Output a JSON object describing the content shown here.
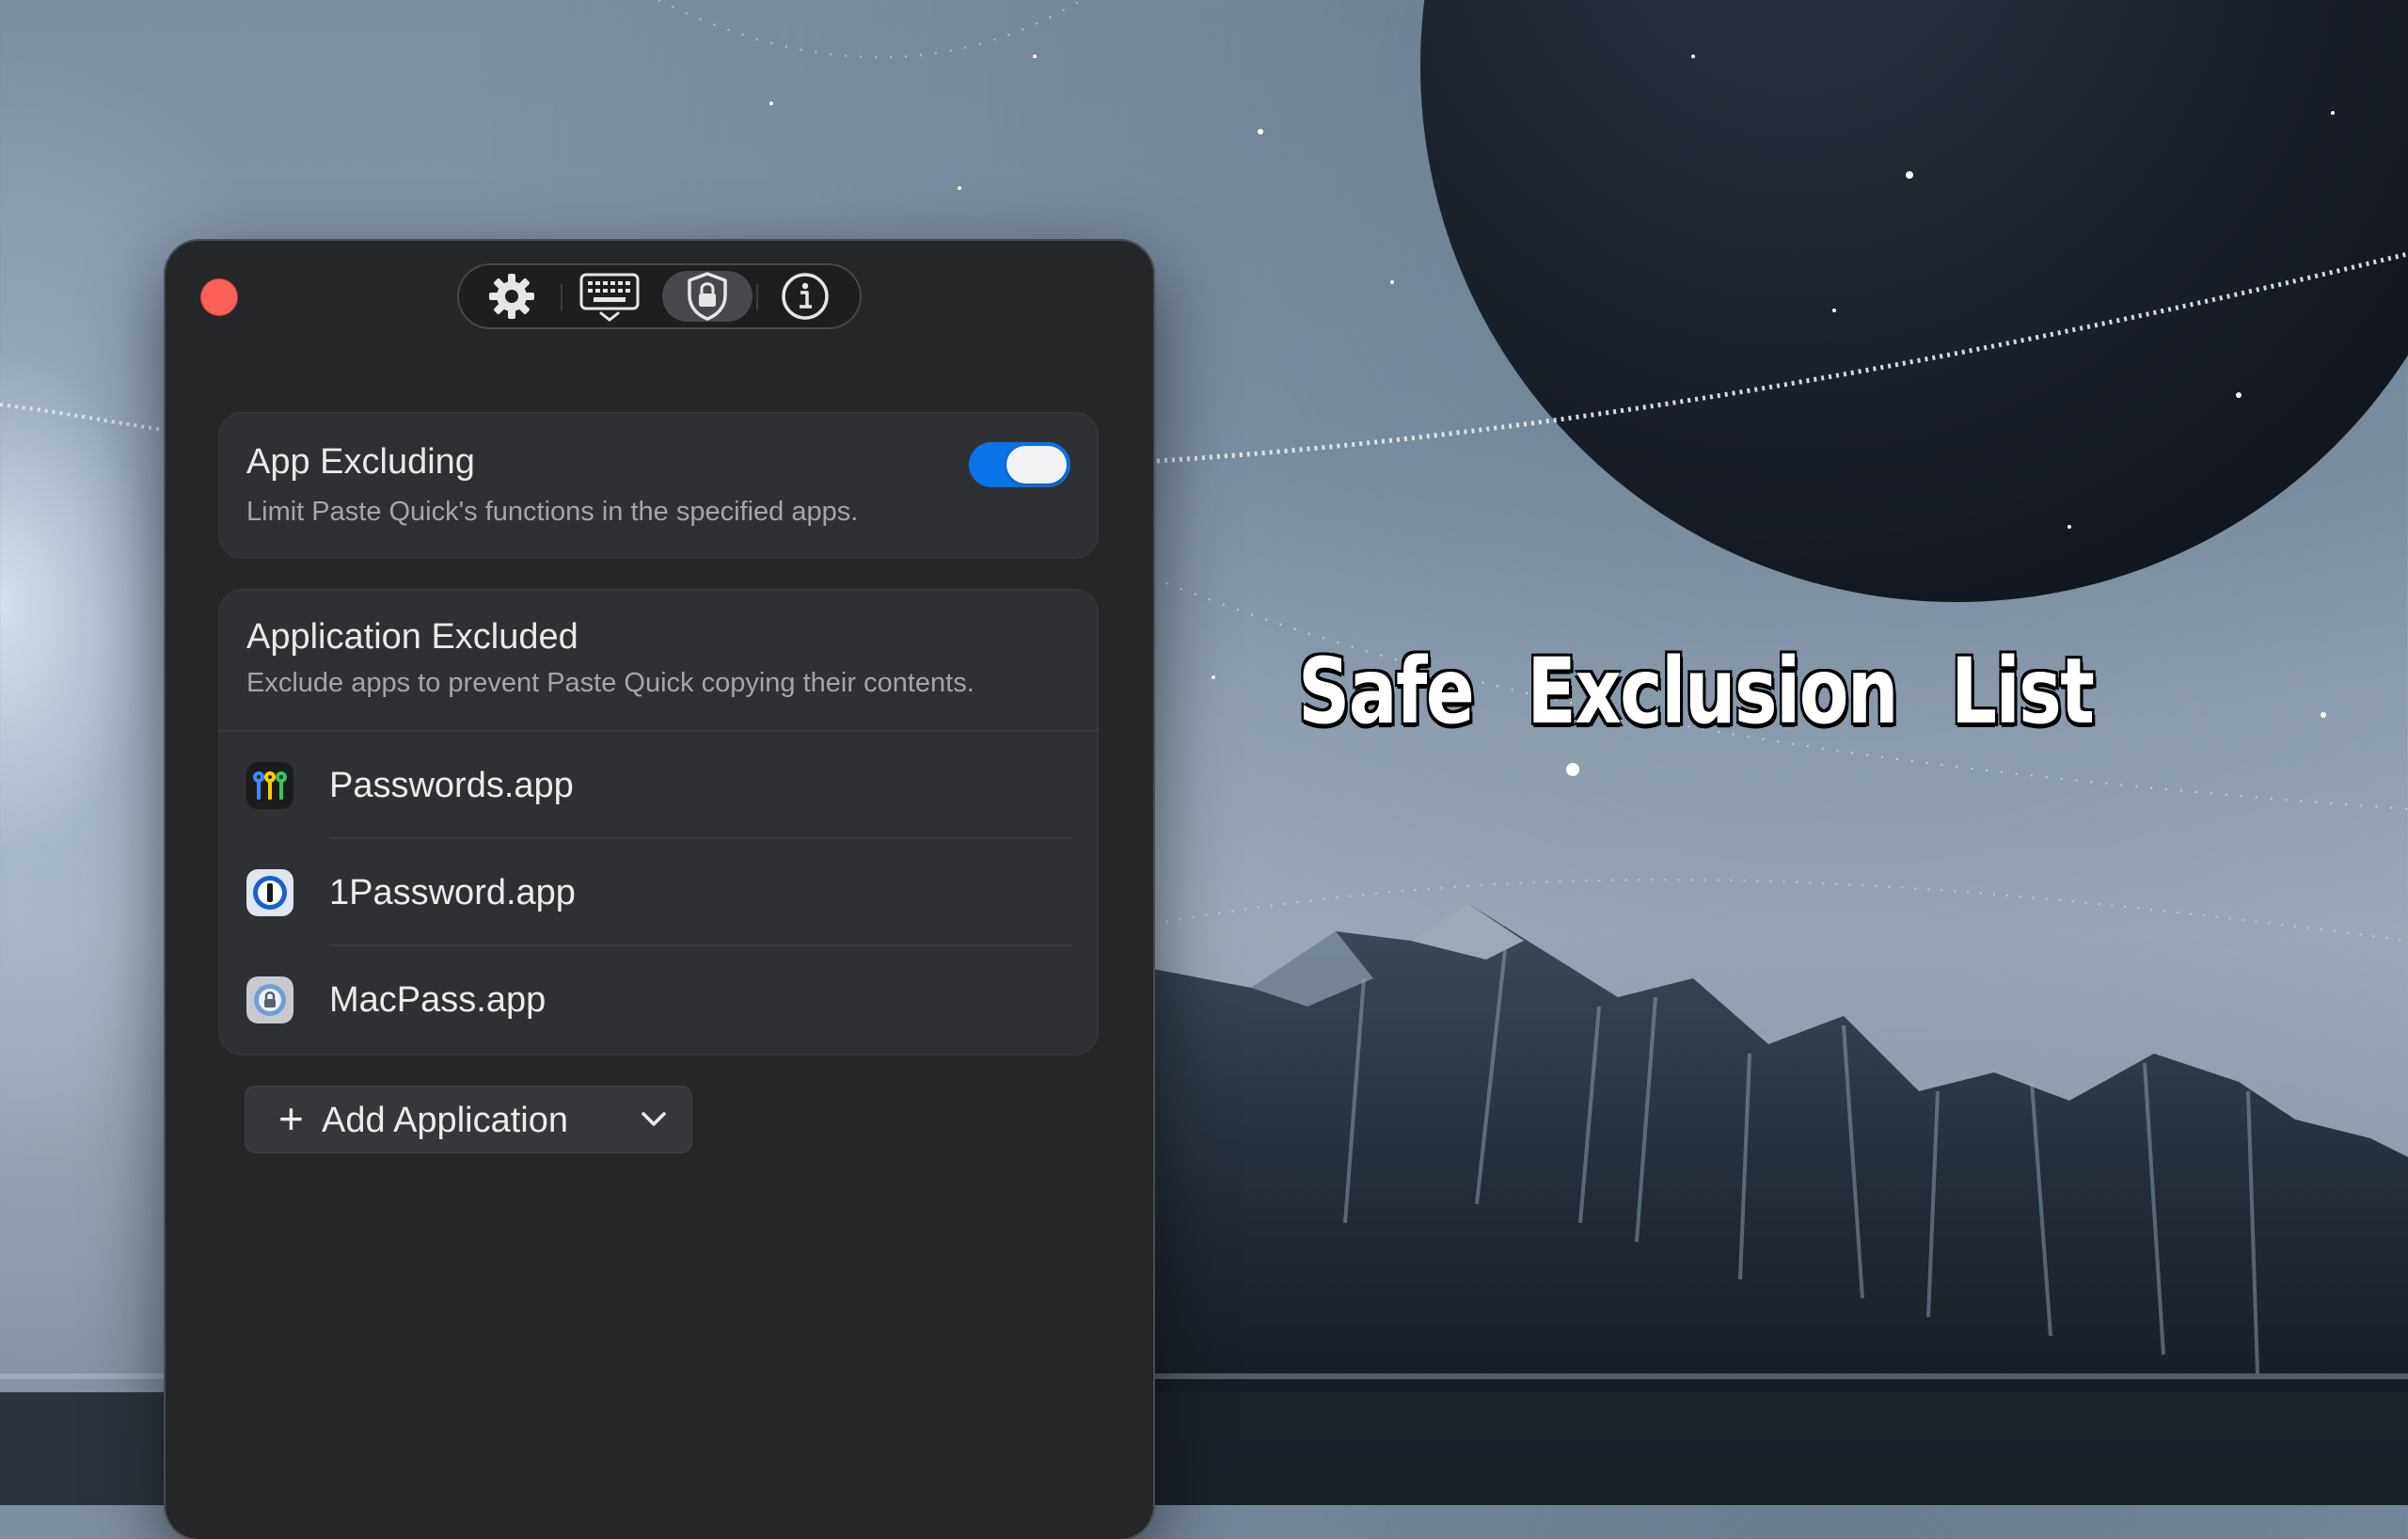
{
  "promo": {
    "headline": "Safe  Exclusion  List"
  },
  "window": {
    "toolbar": {
      "tabs": [
        {
          "icon": "gear-icon",
          "active": false
        },
        {
          "icon": "keyboard-icon",
          "active": false
        },
        {
          "icon": "shield-lock-icon",
          "active": true
        },
        {
          "icon": "info-icon",
          "active": false
        }
      ]
    },
    "app_excluding": {
      "title": "App Excluding",
      "description": "Limit Paste Quick's functions in the specified apps.",
      "enabled": true
    },
    "application_excluded": {
      "title": "Application Excluded",
      "description": "Exclude apps to prevent Paste Quick copying their contents.",
      "apps": [
        {
          "name": "Passwords.app",
          "icon": "passwords-app-icon"
        },
        {
          "name": "1Password.app",
          "icon": "1password-app-icon"
        },
        {
          "name": "MacPass.app",
          "icon": "macpass-app-icon"
        }
      ]
    },
    "add_button": {
      "plus": "+",
      "label": "Add Application"
    }
  },
  "colors": {
    "window_bg": "#252628",
    "card_bg": "#2f3033",
    "toggle_on": "#0a73e8",
    "close_button": "#fe5f57"
  }
}
